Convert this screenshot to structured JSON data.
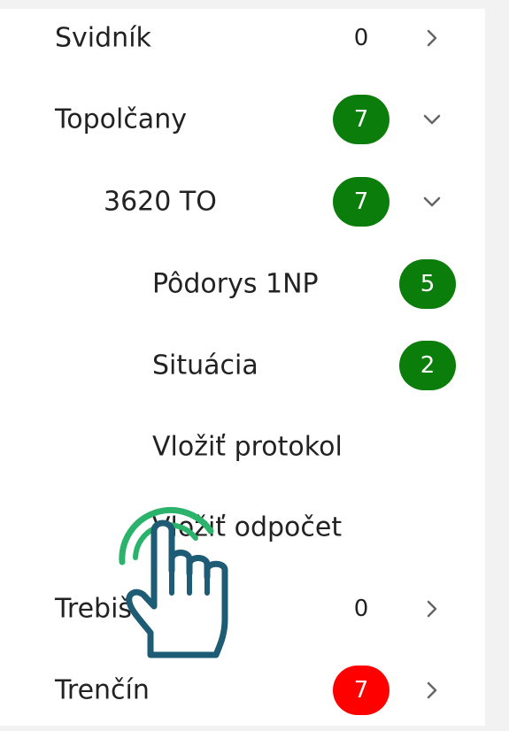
{
  "tree": {
    "items": [
      {
        "label": "Svidník",
        "count": "0",
        "badge": "zero",
        "chevron": "chevron-right-icon"
      },
      {
        "label": "Topolčany",
        "count": "7",
        "badge": "green",
        "chevron": "chevron-down-icon"
      },
      {
        "label": "3620 TO",
        "count": "7",
        "badge": "green",
        "chevron": "chevron-down-icon"
      },
      {
        "label": "Pôdorys 1NP",
        "count": "5",
        "badge": "green"
      },
      {
        "label": "Situácia",
        "count": "2",
        "badge": "green"
      },
      {
        "label": "Vložiť protokol"
      },
      {
        "label": "Vložiť odpočet"
      },
      {
        "label": "Trebišov",
        "count": "0",
        "badge": "zero",
        "chevron": "chevron-right-icon"
      },
      {
        "label": "Trenčín",
        "count": "7",
        "badge": "red",
        "chevron": "chevron-right-icon"
      }
    ]
  },
  "colors": {
    "badge_green": "#0b7d0b",
    "badge_red": "#ff0000",
    "tap_ring": "#2bb36b",
    "hand_outline": "#1e5b74"
  },
  "overlay": {
    "icon": "tap-hand-icon"
  }
}
